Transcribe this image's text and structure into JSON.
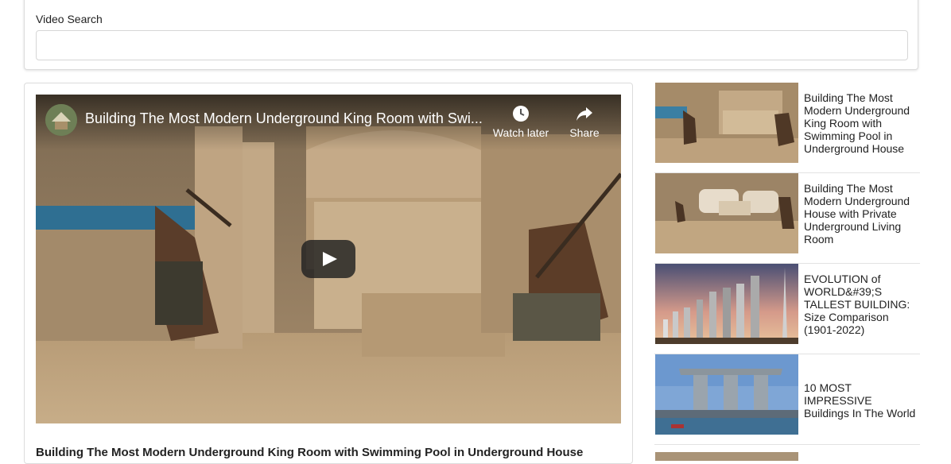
{
  "search": {
    "label": "Video Search",
    "value": "",
    "placeholder": ""
  },
  "player": {
    "title": "Building The Most Modern Underground King Room with Swi...",
    "watch_later_label": "Watch later",
    "share_label": "Share",
    "icons": [
      "clock-icon",
      "share-arrow-icon",
      "play-icon"
    ]
  },
  "detail": {
    "title": "Building The Most Modern Underground King Room with Swimming Pool in Underground House"
  },
  "video_list": [
    {
      "title": "Building The Most Modern Underground King Room with Swimming Pool in Underground House"
    },
    {
      "title": "Building The Most Modern Underground House with Private Underground Living Room"
    },
    {
      "title": "EVOLUTION of WORLD&#39;S TALLEST BUILDING: Size Comparison (1901-2022)"
    },
    {
      "title": "10 MOST IMPRESSIVE Buildings In The World"
    }
  ],
  "colors": {
    "border": "#dcdcdc",
    "text": "#222222",
    "sand": "#b89a72",
    "pool": "#3b7fa3"
  }
}
